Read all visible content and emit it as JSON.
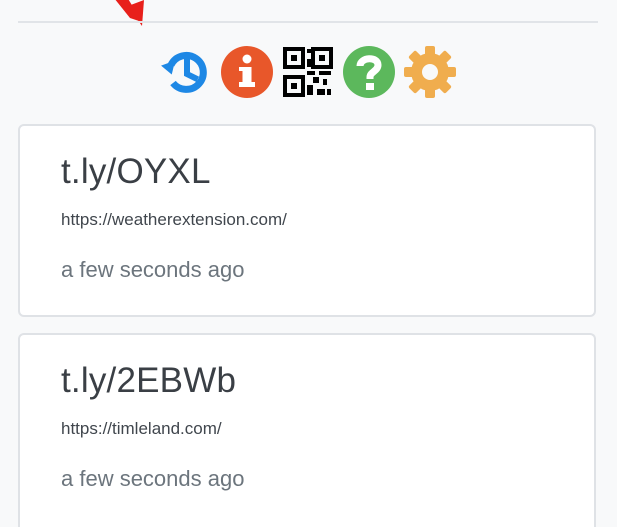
{
  "toolbar": {
    "icons": [
      {
        "name": "history-icon",
        "color": "#1e88e5"
      },
      {
        "name": "info-icon",
        "color": "#e8572a"
      },
      {
        "name": "qr-code-icon",
        "color": "#000000"
      },
      {
        "name": "help-icon",
        "color": "#5cb85c"
      },
      {
        "name": "settings-icon",
        "color": "#f0ad4e"
      }
    ]
  },
  "annotation": {
    "arrow_color": "#e8201b"
  },
  "links": [
    {
      "short_link": "t.ly/OYXL",
      "long_url": "https://weatherextension.com/",
      "created": "a few seconds ago"
    },
    {
      "short_link": "t.ly/2EBWb",
      "long_url": "https://timleland.com/",
      "created": "a few seconds ago"
    }
  ]
}
